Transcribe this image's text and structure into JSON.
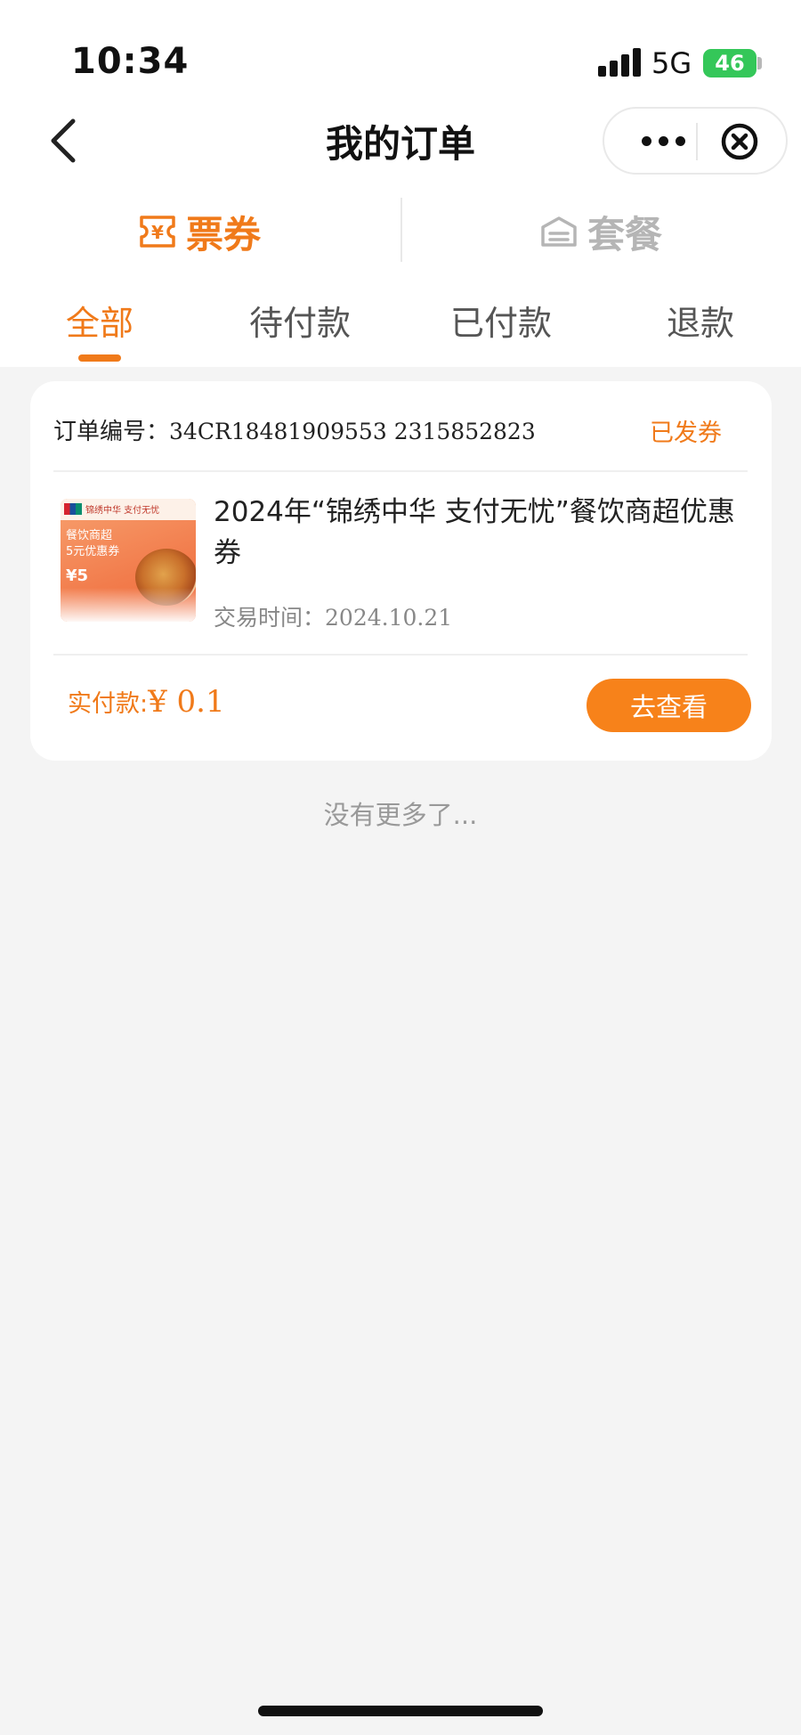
{
  "status_bar": {
    "time": "10:34",
    "network": "5G",
    "battery": "46"
  },
  "header": {
    "title": "我的订单",
    "back_icon": "chevron-left-icon",
    "more_icon": "more-dots-icon",
    "close_icon": "close-circle-icon"
  },
  "categories": [
    {
      "label": "票券",
      "icon": "ticket-icon",
      "active": true
    },
    {
      "label": "套餐",
      "icon": "package-icon",
      "active": false
    }
  ],
  "tabs": [
    {
      "label": "全部",
      "active": true
    },
    {
      "label": "待付款",
      "active": false
    },
    {
      "label": "已付款",
      "active": false
    },
    {
      "label": "退款",
      "active": false
    }
  ],
  "order": {
    "number_label": "订单编号：",
    "number": "34CR18481909553 2315852823",
    "status": "已发券",
    "coupon_image": {
      "brand": "锦绣中华 支付无忧",
      "line1": "餐饮商超",
      "line2": "5元优惠券",
      "price": "¥5"
    },
    "product_title": "2024年“锦绣中华 支付无忧”餐饮商超优惠券",
    "trade_time_label": "交易时间：",
    "trade_time": "2024.10.21",
    "paid_label": "实付款:",
    "paid_amount": "¥ 0.1",
    "view_button": "去查看"
  },
  "footer_hint": "没有更多了...",
  "colors": {
    "accent": "#f07a1a",
    "background": "#f4f4f4",
    "inactive": "#b5b5b5"
  }
}
